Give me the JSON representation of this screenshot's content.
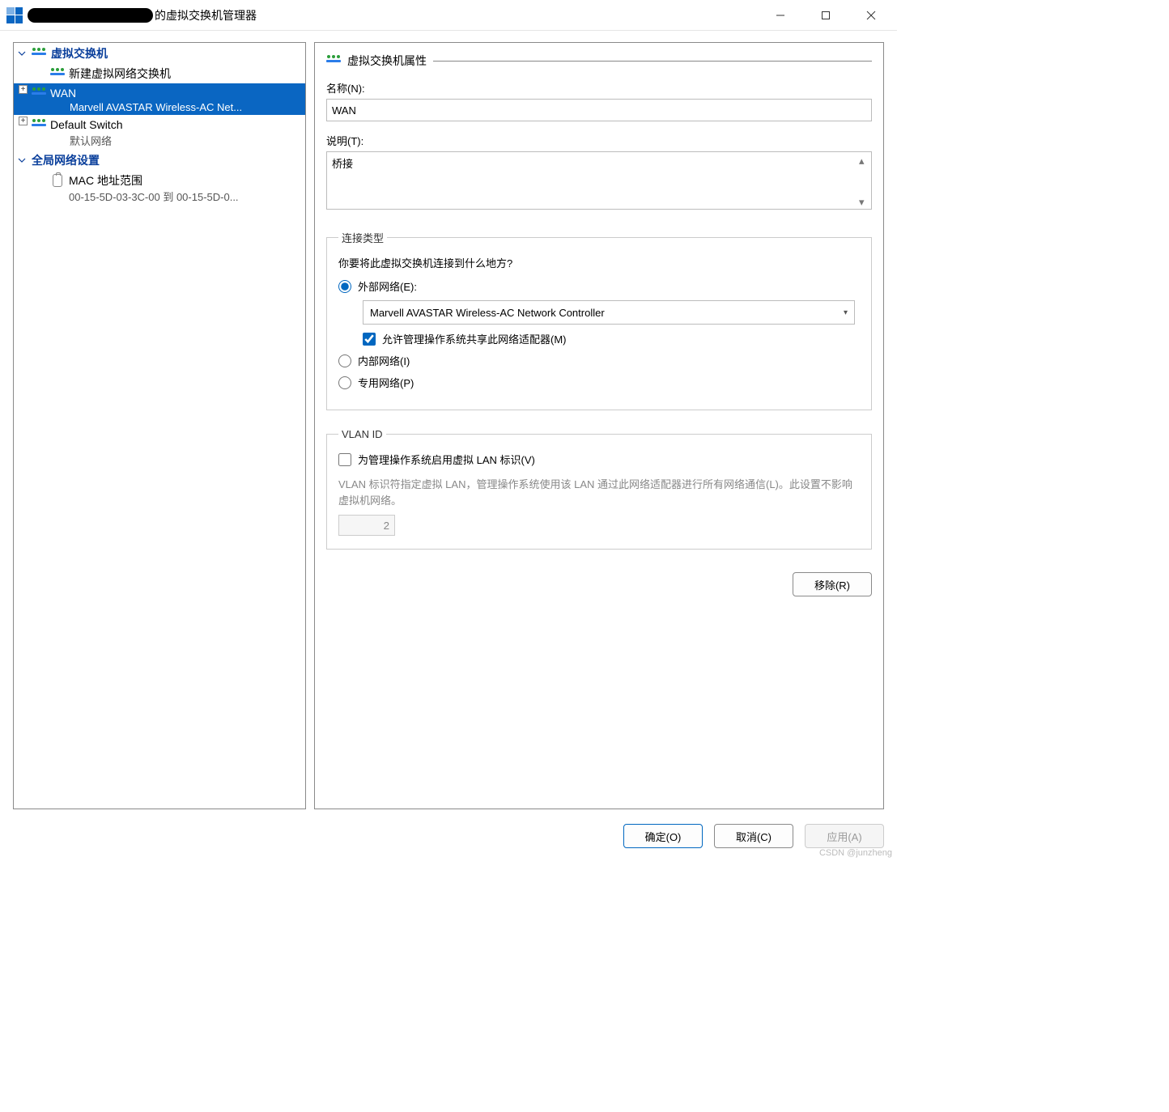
{
  "window": {
    "title_suffix": " 的虚拟交换机管理器"
  },
  "tree": {
    "section_switches": "虚拟交换机",
    "new_switch": "新建虚拟网络交换机",
    "wan": {
      "name": "WAN",
      "adapter": "Marvell AVASTAR Wireless-AC Net..."
    },
    "default_switch": {
      "name": "Default Switch",
      "sub": "默认网络"
    },
    "section_global": "全局网络设置",
    "mac_range": {
      "name": "MAC 地址范围",
      "range": "00-15-5D-03-3C-00 到 00-15-5D-0..."
    }
  },
  "props": {
    "section_title": "虚拟交换机属性",
    "name_label": "名称(N):",
    "name_value": "WAN",
    "desc_label": "说明(T):",
    "desc_value": "桥接"
  },
  "conn": {
    "legend": "连接类型",
    "question": "你要将此虚拟交换机连接到什么地方?",
    "external_label": "外部网络(E):",
    "adapter_selected": "Marvell AVASTAR Wireless-AC Network Controller",
    "allow_mgmt_label": "允许管理操作系统共享此网络适配器(M)",
    "internal_label": "内部网络(I)",
    "private_label": "专用网络(P)",
    "selected": "external",
    "allow_mgmt_checked": true
  },
  "vlan": {
    "legend": "VLAN ID",
    "enable_label": "为管理操作系统启用虚拟 LAN 标识(V)",
    "enabled": false,
    "desc": "VLAN 标识符指定虚拟 LAN，管理操作系统使用该 LAN 通过此网络适配器进行所有网络通信(L)。此设置不影响虚拟机网络。",
    "value": "2"
  },
  "buttons": {
    "remove": "移除(R)",
    "ok": "确定(O)",
    "cancel": "取消(C)",
    "apply": "应用(A)"
  },
  "watermark": "CSDN @junzheng"
}
